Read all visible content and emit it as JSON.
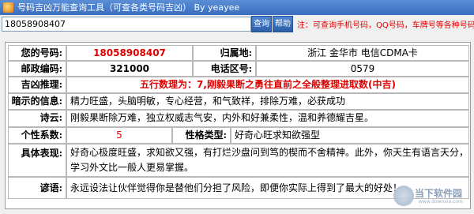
{
  "window": {
    "title": "号码吉凶万能查询工具（可查各类号码吉凶） By yeayee"
  },
  "toolbar": {
    "query_value": "18058908407",
    "query_label": "查询",
    "help_label": "帮助",
    "notice": "注：可查询手机号码，QQ号码，车牌号等各种号码吉凶，仅供参考"
  },
  "result": {
    "number_label": "您的号码:",
    "number_value": "18058908407",
    "location_label": "归属地:",
    "location_value": "浙江 金华市  电信CDMA卡",
    "postcode_label": "邮政编码:",
    "postcode_value": "321000",
    "areacode_label": "电话区号:",
    "areacode_value": "0579",
    "inference_label": "吉凶推理:",
    "inference_value": "五行数理为：7,刚毅果断之勇往直前之全般整理进取数(中吉)",
    "hint_label": "暗示的信息:",
    "hint_value": "精力旺盛，头脑明敏，专心经营，和气致祥，排除万难，必获成功",
    "poem_label": "诗云:",
    "poem_value": "刚毅果断除万难，独立权威志气安，内外和好兼柔性，温和养德耀吉星。",
    "personality_label": "个性系数:",
    "personality_value": "5",
    "trait_label": "性格类型:",
    "trait_value": "好奇心旺求知欲强型",
    "behavior_label": "具体表现:",
    "behavior_value": "好奇心极度旺盛，求知欲又强，有打烂沙盘问到笃的楔而不舍精神。此外，你天生有语言天分，学习外文比一般人更易掌握。",
    "proverb_label": "谚语:",
    "proverb_value": "永远设法让伙伴觉得你是替他们分担了风险，即便你实际上得到了最大的好处！"
  },
  "watermark": {
    "text": "当下软件园",
    "sub": "www.downxia.com"
  }
}
